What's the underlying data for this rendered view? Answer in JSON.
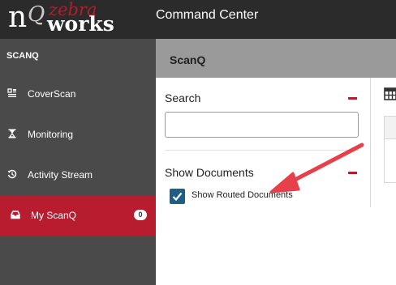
{
  "header": {
    "logo": {
      "n": "n",
      "q": "Q",
      "zebra": "zebra",
      "works": "works"
    },
    "title": "Command Center"
  },
  "sidebar": {
    "section": "SCANQ",
    "items": [
      {
        "label": "CoverScan",
        "icon": "coverscan-icon"
      },
      {
        "label": "Monitoring",
        "icon": "hourglass-icon"
      },
      {
        "label": "Activity Stream",
        "icon": "history-icon"
      },
      {
        "label": "My ScanQ",
        "icon": "inbox-icon",
        "badge": "0",
        "active": true
      }
    ]
  },
  "main": {
    "title": "ScanQ",
    "search": {
      "title": "Search",
      "value": "",
      "placeholder": ""
    },
    "show_documents": {
      "title": "Show Documents",
      "checkbox_label": "Show Routed Documents",
      "checked": true
    }
  },
  "colors": {
    "topbar": "#2b2b2b",
    "sidebar": "#4a4a4a",
    "accent": "#b71c2f",
    "checkbox": "#1e5f85",
    "annotation_arrow": "#e8404a"
  }
}
